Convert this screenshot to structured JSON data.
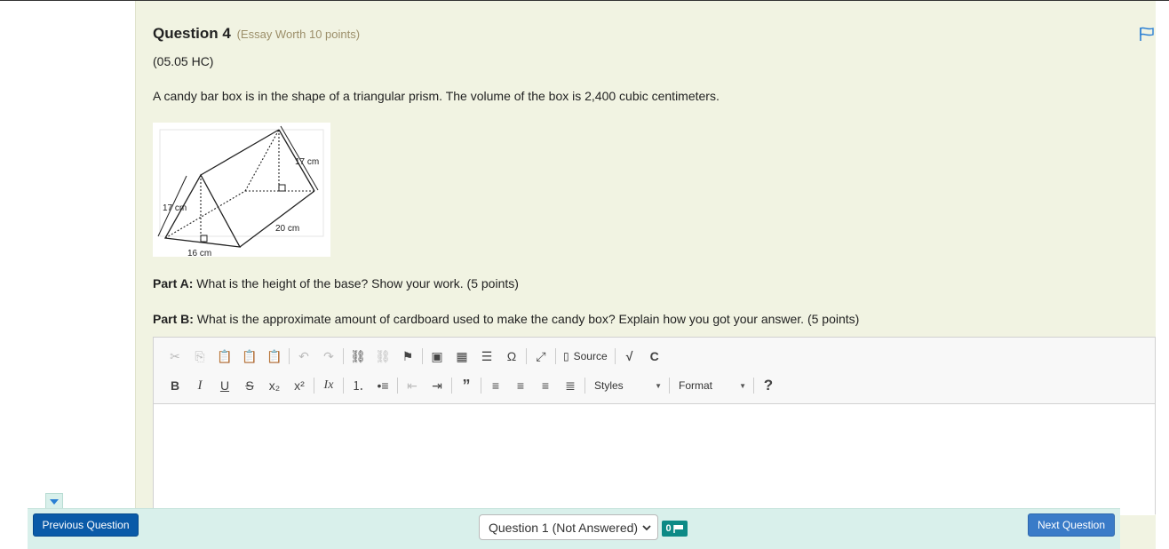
{
  "question": {
    "title": "Question 4",
    "worth": "(Essay Worth 10 points)",
    "code": "(05.05 HC)",
    "text": "A candy bar box is in the shape of a triangular prism. The volume of the box is 2,400 cubic centimeters.",
    "figure_labels": {
      "slant_top": "17 cm",
      "slant_left": "17 cm",
      "length": "20 cm",
      "base": "16 cm"
    },
    "part_a_label": "Part A:",
    "part_a_text": " What is the height of the base? Show your work. (5 points)",
    "part_b_label": "Part B:",
    "part_b_text": " What is the approximate amount of cardboard used to make the candy box? Explain how you got your answer. (5 points)"
  },
  "editor": {
    "source_label": "Source",
    "styles_label": "Styles",
    "format_label": "Format",
    "help_label": "?",
    "toolbar_row1_icons": [
      "cut-icon",
      "copy-icon",
      "paste-icon",
      "paste-text-icon",
      "paste-word-icon",
      "undo-icon",
      "redo-icon",
      "link-icon",
      "unlink-icon",
      "anchor-icon",
      "image-icon",
      "table-icon",
      "horizontal-rule-icon",
      "special-char-icon",
      "maximize-icon",
      "source-icon",
      "math-icon",
      "chemistry-icon"
    ],
    "toolbar_row2_icons": [
      "bold-icon",
      "italic-icon",
      "underline-icon",
      "strike-icon",
      "subscript-icon",
      "superscript-icon",
      "remove-format-icon",
      "numbered-list-icon",
      "bulleted-list-icon",
      "outdent-icon",
      "indent-icon",
      "blockquote-icon",
      "align-left-icon",
      "align-center-icon",
      "align-right-icon",
      "justify-icon"
    ]
  },
  "footer": {
    "prev_label": "Previous Question",
    "next_label": "Next Question",
    "question_select": "Question 1 (Not Answered)",
    "flag_count": "0"
  },
  "colors": {
    "panel_bg": "#f1f3e2",
    "footer_bg": "#d9f0eb",
    "prev_btn": "#0a5aa8",
    "next_btn": "#3a7bc8",
    "flag_badge": "#0d8a86",
    "flag_icon": "#2a7fd4"
  }
}
